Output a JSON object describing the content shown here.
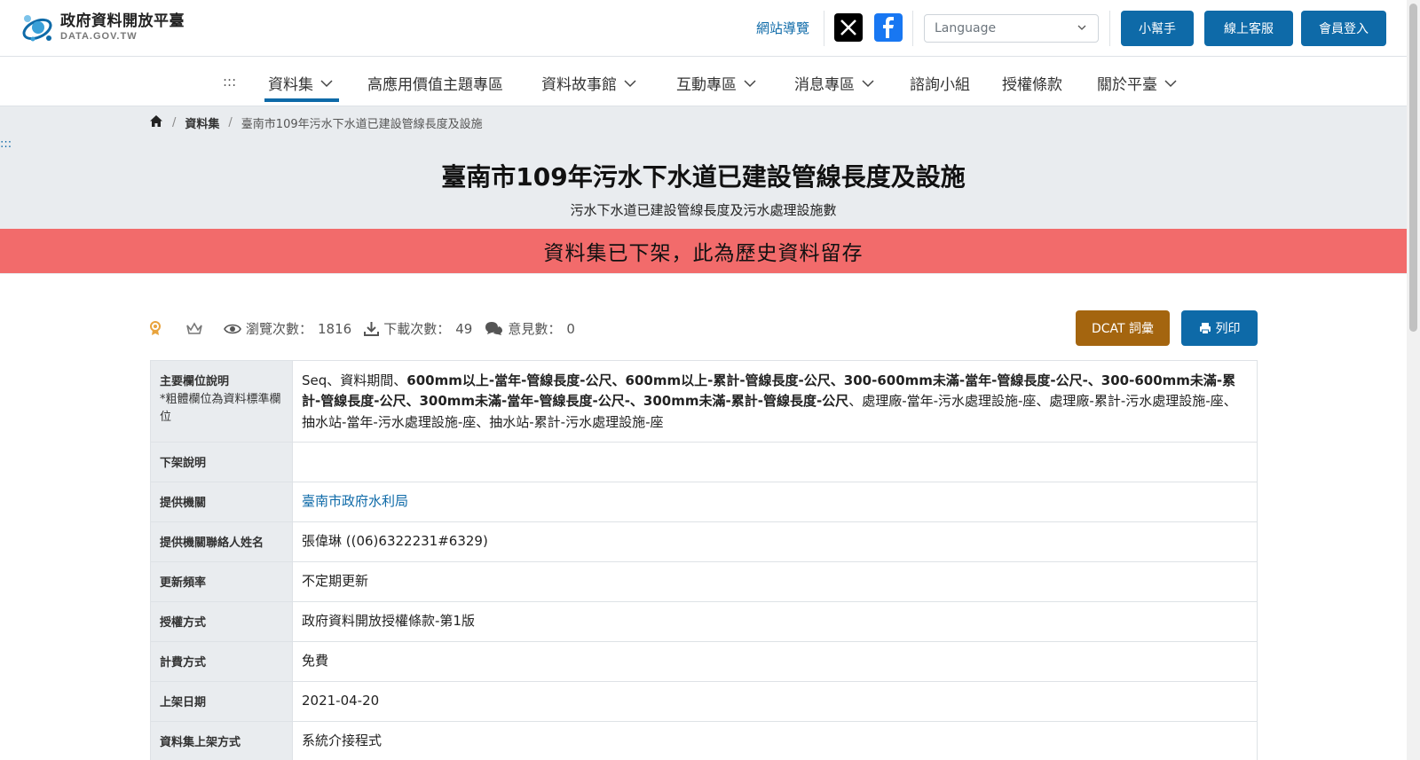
{
  "header": {
    "logo_title": "政府資料開放平臺",
    "logo_sub": "DATA.GOV.TW",
    "sitemap": "網站導覽",
    "language_placeholder": "Language",
    "helper_btn": "小幫手",
    "support_btn": "線上客服",
    "login_btn": "會員登入",
    "brand_color": "#0e6aa8"
  },
  "nav": {
    "accesskey": ":::",
    "items": [
      {
        "label": "資料集"
      },
      {
        "label": "高應用價值主題專區"
      },
      {
        "label": "資料故事館"
      },
      {
        "label": "互動專區"
      },
      {
        "label": "消息專區"
      },
      {
        "label": "諮詢小組"
      },
      {
        "label": "授權條款"
      },
      {
        "label": "關於平臺"
      }
    ]
  },
  "breadcrumb": {
    "items": [
      "資料集",
      "臺南市109年污水下水道已建設管線長度及設施"
    ]
  },
  "band_accesskey": ":::",
  "page": {
    "title": "臺南市109年污水下水道已建設管線長度及設施",
    "subtitle": "污水下水道已建設管線長度及污水處理設施數",
    "alert": "資料集已下架，此為歷史資料留存",
    "alert_color": "#f26b6b"
  },
  "stats": {
    "views_label": "瀏覽次數：",
    "views": "1816",
    "downloads_label": "下載次數：",
    "downloads": "49",
    "comments_label": "意見數：",
    "comments": "0"
  },
  "actions": {
    "dcat": "DCAT 詞彙",
    "print": "列印"
  },
  "fields": {
    "main_label": "主要欄位說明",
    "main_note": "*粗體欄位為資料標準欄位",
    "main_value_1": "Seq、資料期間、",
    "main_value_bold": "600mm以上-當年-管線長度-公尺、600mm以上-累計-管線長度-公尺、300-600mm未滿-當年-管線長度-公尺-、300-600mm未滿-累計-管線長度-公尺、300mm未滿-當年-管線長度-公尺-、300mm未滿-累計-管線長度-公尺",
    "main_value_2": "、處理廠-當年-污水處理設施-座、處理廠-累計-污水處理設施-座、抽水站-當年-污水處理設施-座、抽水站-累計-污水處理設施-座",
    "rows": [
      {
        "label": "下架說明",
        "value": ""
      },
      {
        "label": "提供機關",
        "value": "臺南市政府水利局"
      },
      {
        "label": "提供機關聯絡人姓名",
        "value": "張偉琳 ((06)6322231#6329)"
      },
      {
        "label": "更新頻率",
        "value": "不定期更新"
      },
      {
        "label": "授權方式",
        "value": "政府資料開放授權條款-第1版"
      },
      {
        "label": "計費方式",
        "value": "免費"
      },
      {
        "label": "上架日期",
        "value": "2021-04-20"
      },
      {
        "label": "資料集上架方式",
        "value": "系統介接程式"
      }
    ]
  }
}
